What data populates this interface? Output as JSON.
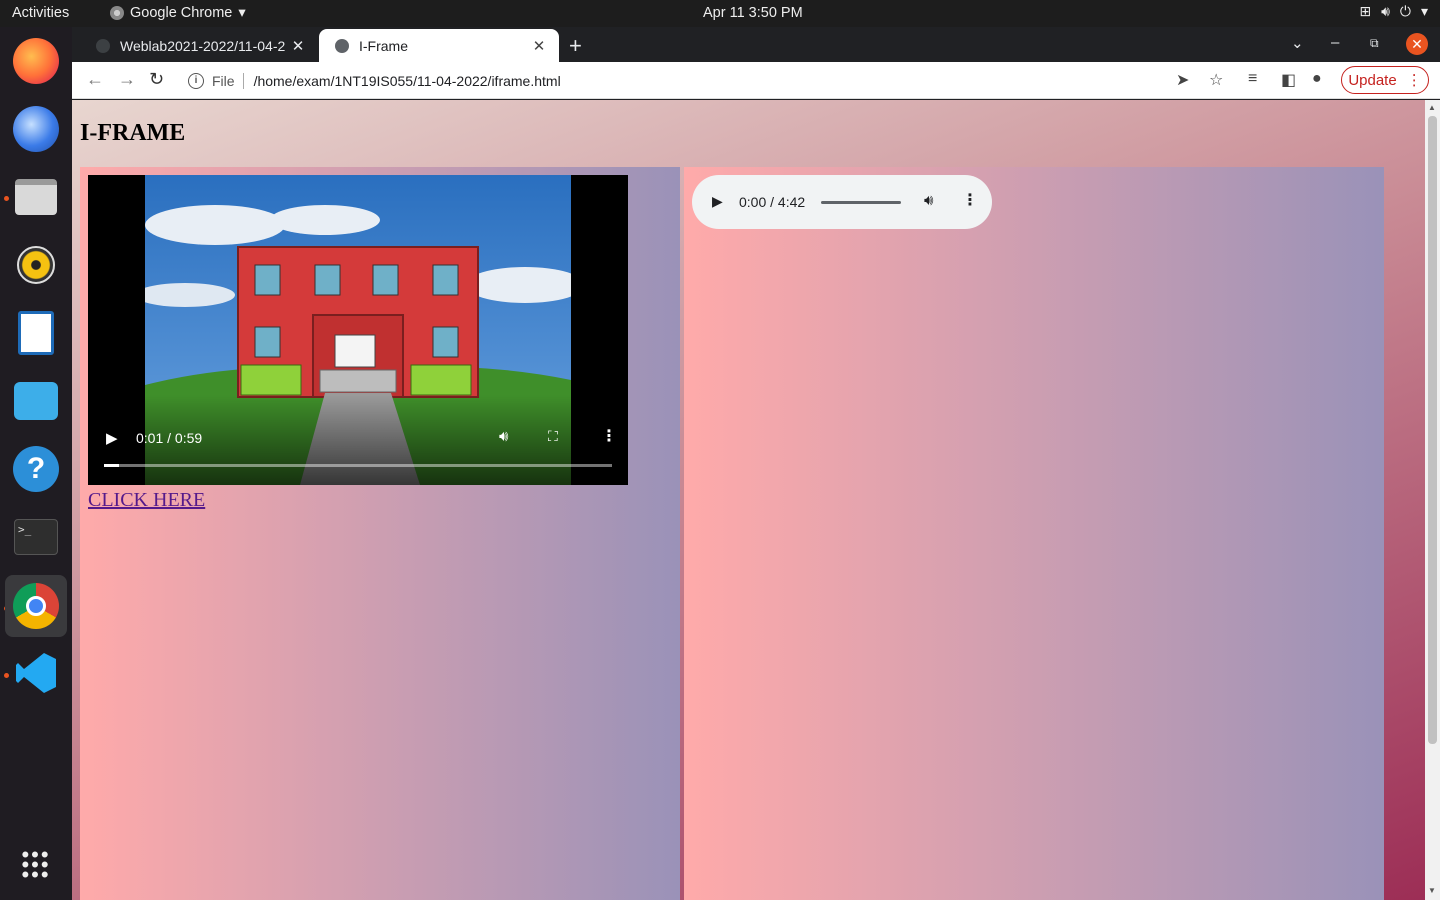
{
  "topbar": {
    "activities": "Activities",
    "app_name": "Google Chrome",
    "clock": "Apr 11  3:50 PM"
  },
  "dock": {
    "items": [
      "firefox",
      "thunderbird",
      "files",
      "rhythmbox",
      "libreoffice-writer",
      "software-center",
      "help",
      "terminal",
      "chrome",
      "vscode"
    ]
  },
  "browser": {
    "tabs": [
      {
        "title": "Weblab2021-2022/11-04-2",
        "active": false
      },
      {
        "title": "I-Frame",
        "active": true
      }
    ],
    "address": {
      "scheme_label": "File",
      "url": "/home/exam/1NT19IS055/11-04-2022/iframe.html"
    },
    "update_label": "Update"
  },
  "page": {
    "title": "I-FRAME",
    "video": {
      "current_time": "0:01",
      "duration": "0:59",
      "time_text": "0:01 / 0:59",
      "progress_fraction": 0.03
    },
    "link_text": "CLICK HERE",
    "audio": {
      "time_text": "0:00 / 4:42"
    }
  },
  "colors": {
    "accent": "#e95420",
    "link_visited": "#551a8b",
    "update_red": "#c5221f"
  }
}
